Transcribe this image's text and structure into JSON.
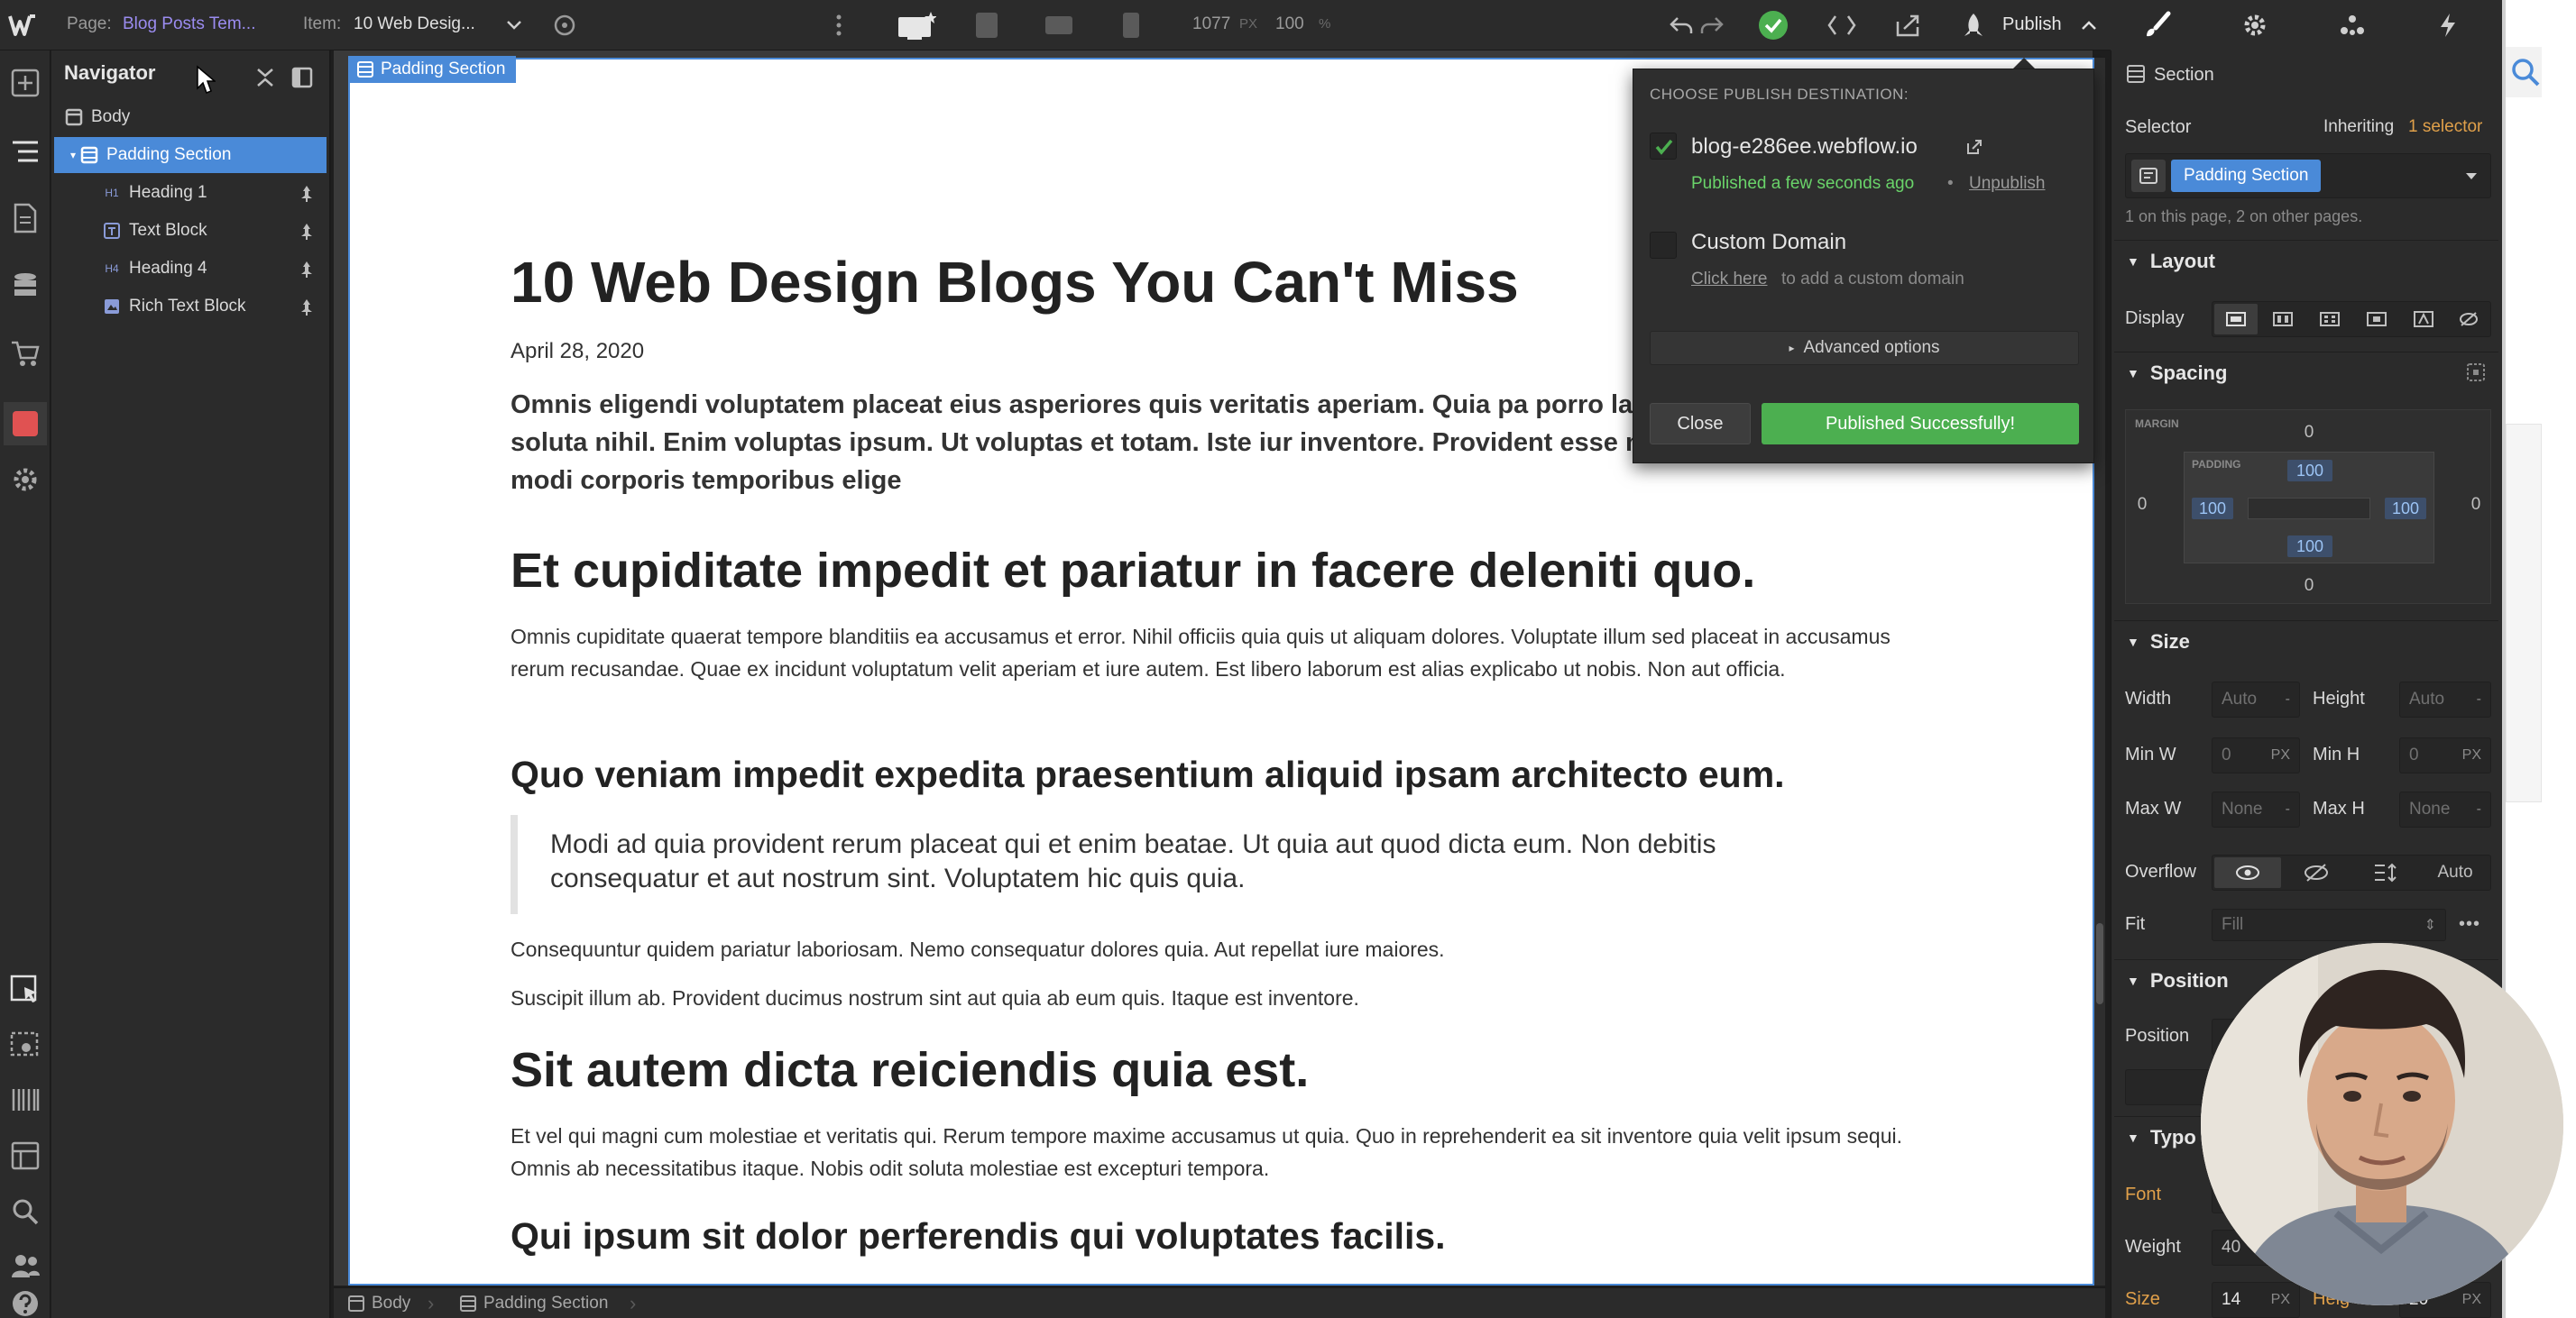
{
  "topbar": {
    "page_label": "Page:",
    "page_value": "Blog Posts Tem...",
    "item_label": "Item:",
    "item_value": "10 Web Desig...",
    "width_value": "1077",
    "width_unit": "PX",
    "zoom_value": "100",
    "zoom_unit": "%",
    "publish_label": "Publish"
  },
  "navigator": {
    "title": "Navigator",
    "items": [
      {
        "label": "Body"
      },
      {
        "label": "Padding Section"
      },
      {
        "label": "Heading 1"
      },
      {
        "label": "Text Block"
      },
      {
        "label": "Heading 4"
      },
      {
        "label": "Rich Text Block"
      }
    ]
  },
  "canvas": {
    "selection_tag": "Padding Section",
    "article": {
      "title": "10 Web Design Blogs You Can't Miss",
      "date": "April 28, 2020",
      "intro": "Omnis eligendi voluptatem placeat eius asperiores quis veritatis aperiam. Quia pa porro laboriosam soluta nihil. Enim voluptas ipsum. Ut voluptas et totam. Iste iur inventore. Provident esse non. Harum modi corporis temporibus elige",
      "h2_1": "Et cupiditate impedit et pariatur in facere deleniti quo.",
      "p1": "Omnis cupiditate quaerat tempore blanditiis ea accusamus et error. Nihil officiis quia quis ut aliquam dolores. Voluptate illum sed placeat in accusamus rerum recusandae. Quae ex incidunt voluptatum velit aperiam et iure autem. Est libero laborum est alias explicabo ut nobis. Non aut officia.",
      "h3_1": "Quo veniam impedit expedita praesentium aliquid ipsam architecto eum.",
      "quote": "Modi ad quia provident rerum placeat qui et enim beatae. Ut quia aut quod dicta eum. Non debitis consequatur et aut nostrum sint. Voluptatem hic quis quia.",
      "p2": "Consequuntur quidem pariatur laboriosam. Nemo consequatur dolores quia. Aut repellat iure maiores.",
      "p3": "Suscipit illum ab. Provident ducimus nostrum sint aut quia ab eum quis. Itaque est inventore.",
      "h2_2": "Sit autem dicta reiciendis quia est.",
      "p4": "Et vel qui magni cum molestiae et veritatis qui. Rerum tempore maxime accusamus ut quia. Quo in reprehenderit ea sit inventore quia velit ipsum sequi. Omnis ab necessitatibus itaque. Nobis odit soluta molestiae est excepturi tempora.",
      "h3_2": "Qui ipsum sit dolor perferendis qui voluptates facilis."
    }
  },
  "breadcrumb": {
    "items": [
      "Body",
      "Padding Section"
    ]
  },
  "publish_popup": {
    "title": "CHOOSE PUBLISH DESTINATION:",
    "dest1_domain": "blog-e286ee.webflow.io",
    "dest1_status": "Published a few seconds ago",
    "dest1_separator": "•",
    "dest1_unpublish": "Unpublish",
    "dest2_title": "Custom Domain",
    "dest2_link": "Click here",
    "dest2_rest": "to add a custom domain",
    "advanced": "Advanced options",
    "close": "Close",
    "published": "Published Successfully!"
  },
  "style_panel": {
    "element_type": "Section",
    "selector_label": "Selector",
    "inheriting_prefix": "Inheriting",
    "inheriting_count": "1 selector",
    "selector_value": "Padding Section",
    "usage_note": "1 on this page, 2 on other pages.",
    "layout": {
      "title": "Layout",
      "display_label": "Display"
    },
    "spacing": {
      "title": "Spacing",
      "margin_label": "MARGIN",
      "padding_label": "PADDING",
      "margin_top": "0",
      "margin_right": "0",
      "margin_bottom": "0",
      "margin_left": "0",
      "padding_top": "100",
      "padding_right": "100",
      "padding_bottom": "100",
      "padding_left": "100"
    },
    "size": {
      "title": "Size",
      "width_label": "Width",
      "width_value": "Auto",
      "height_label": "Height",
      "height_value": "Auto",
      "minw_label": "Min W",
      "minw_value": "0",
      "minw_unit": "PX",
      "minh_label": "Min H",
      "minh_value": "0",
      "minh_unit": "PX",
      "maxw_label": "Max W",
      "maxw_value": "None",
      "maxh_label": "Max H",
      "maxh_value": "None",
      "overflow_label": "Overflow",
      "overflow_auto": "Auto",
      "fit_label": "Fit",
      "fit_value": "Fill"
    },
    "position": {
      "title": "Position",
      "position_label": "Position"
    },
    "typography": {
      "title": "Typo",
      "font_label": "Font",
      "weight_label": "Weight",
      "weight_value": "40",
      "size_label": "Size",
      "size_value": "14",
      "size_unit": "PX",
      "height_label": "Heig",
      "height_value": "20",
      "height_unit": "PX"
    }
  },
  "colors": {
    "accent_blue": "#4a8ad8",
    "publish_green": "#4caf50",
    "status_green": "#6ad46a",
    "link_purple": "#9b8cf0"
  }
}
